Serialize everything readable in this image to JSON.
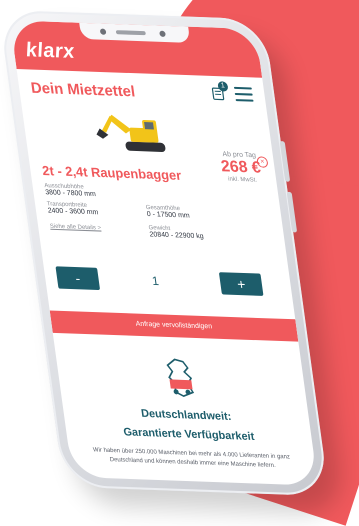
{
  "brand": {
    "logo_text": "klarx",
    "accent": "#f0595c",
    "dark": "#1d5d6b"
  },
  "header": {
    "cart_count": "1"
  },
  "page": {
    "title": "Dein Mietzettel"
  },
  "product": {
    "name": "2t - 2,4t Raupenbagger",
    "price_label": "Ab pro Tag",
    "price_value": "268 €",
    "price_note": "inkl. MwSt.",
    "specs": [
      {
        "label": "Ausschubhöhe",
        "value": "3800 - 7800 mm"
      },
      {
        "label": "Gesamthöhe",
        "value": "0 - 17500 mm"
      },
      {
        "label": "Transportbreite",
        "value": "2400 - 3600 mm"
      },
      {
        "label": "Gewicht",
        "value": "20840 - 22900 kg"
      }
    ],
    "details_link": "Siehe alle Details >",
    "quantity": "1",
    "minus_label": "-",
    "plus_label": "+"
  },
  "cta": {
    "label": "Anfrage vervollständigen"
  },
  "feature": {
    "title_line1": "Deutschlandweit:",
    "title_line2": "Garantierte Verfügbarkeit",
    "text": "Wir haben über 250.000 Maschinen bei mehr als 4.000 Lieferanten in ganz Deutschland und können deshalb immer eine Maschine liefern."
  }
}
